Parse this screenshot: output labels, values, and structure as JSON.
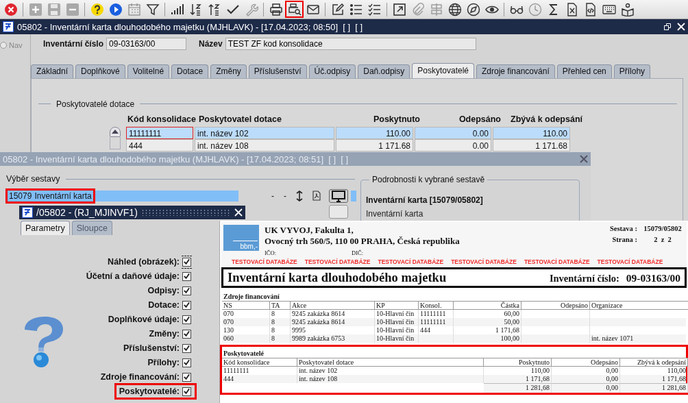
{
  "toolbar": {
    "items": [
      {
        "kind": "close",
        "marked": false
      },
      {
        "kind": "separator"
      },
      {
        "kind": "add",
        "marked": false
      },
      {
        "kind": "save",
        "marked": false
      },
      {
        "kind": "remove",
        "marked": false
      },
      {
        "kind": "separator"
      },
      {
        "kind": "help",
        "marked": false
      },
      {
        "kind": "run",
        "marked": false
      },
      {
        "kind": "calendar",
        "marked": false
      },
      {
        "kind": "filter",
        "marked": false
      },
      {
        "kind": "separator"
      },
      {
        "kind": "signal",
        "marked": false
      },
      {
        "kind": "sort-down",
        "marked": false
      },
      {
        "kind": "sort-up",
        "marked": false
      },
      {
        "kind": "check",
        "marked": false
      },
      {
        "kind": "wrench",
        "marked": false
      },
      {
        "kind": "separator"
      },
      {
        "kind": "printer",
        "marked": false
      },
      {
        "kind": "print-preview",
        "marked": true
      },
      {
        "kind": "mail",
        "marked": false
      },
      {
        "kind": "separator"
      },
      {
        "kind": "edit",
        "marked": false
      },
      {
        "kind": "list",
        "marked": false
      },
      {
        "kind": "checklist",
        "marked": false
      },
      {
        "kind": "separator"
      },
      {
        "kind": "external",
        "marked": false
      },
      {
        "kind": "paperclip",
        "marked": false
      },
      {
        "kind": "signpost",
        "marked": false
      },
      {
        "kind": "globe",
        "marked": false
      },
      {
        "kind": "compass",
        "marked": false
      },
      {
        "kind": "eye",
        "marked": false
      },
      {
        "kind": "separator"
      },
      {
        "kind": "glasses",
        "marked": false
      },
      {
        "kind": "clock",
        "marked": false
      },
      {
        "kind": "sum",
        "marked": false
      },
      {
        "kind": "spreadsheet",
        "marked": false
      },
      {
        "kind": "code",
        "marked": false
      },
      {
        "kind": "keyboard",
        "marked": false
      },
      {
        "kind": "reader",
        "marked": false
      }
    ]
  },
  "main_window": {
    "title": "05802 - Inventární karta dlouhodobého majetku (MJHLAVK) - [17.04.2023; 08:50]  [ ]  [ ]",
    "nav": {
      "label": "Nav",
      "selected": false
    },
    "fields": [
      {
        "label": "Inventární číslo",
        "value": "09-03163/00"
      },
      {
        "label": "Název",
        "value": "TEST ZF kod konsolidace"
      }
    ],
    "tabs": [
      {
        "label": "Základní",
        "selected": false
      },
      {
        "label": "Doplňkové",
        "selected": false
      },
      {
        "label": "Volitelné",
        "selected": false
      },
      {
        "label": "Dotace",
        "selected": false
      },
      {
        "label": "Změny",
        "selected": false
      },
      {
        "label": "Příslušenství",
        "selected": false
      },
      {
        "label": "Úč.odpisy",
        "selected": false
      },
      {
        "label": "Daň.odpisy",
        "selected": false
      },
      {
        "label": "Poskytovatelé",
        "selected": true
      },
      {
        "label": "Zdroje financování",
        "selected": false
      },
      {
        "label": "Přehled cen",
        "selected": false
      },
      {
        "label": "Přílohy",
        "selected": false
      }
    ],
    "section_title": "Poskytovatelé dotace",
    "table": {
      "columns": [
        "Kód konsolidace",
        "Poskytovatel dotace",
        "Poskytnuto",
        "Odepsáno",
        "Zbývá k odepsání"
      ],
      "rows": [
        {
          "cells": [
            "11111111",
            "int. název 102",
            "110.00",
            "0.00",
            "110.00"
          ],
          "selected": true,
          "focused": true
        },
        {
          "cells": [
            "444",
            "int. název 108",
            "1 171.68",
            "0.00",
            "1 171.68"
          ],
          "selected": false,
          "focused": false
        }
      ]
    }
  },
  "report_window": {
    "title": "05802 - Inventární karta dlouhodobého majetku (MJHLAVK) - [17.04.2023; 08:51]  [ ]  [ ]",
    "selection_title": "Výběr sestavy",
    "reports": [
      {
        "code": "15079",
        "name": "Inventární karta",
        "selected": true,
        "marked": true
      }
    ],
    "tools": [
      "-",
      "-"
    ],
    "details": {
      "title": "Podrobnosti k vybrané sestavě",
      "heading": "Inventární karta [15079/05802]",
      "description": "Inventární karta"
    }
  },
  "dialog": {
    "title": "/05802 - (RJ_MJINVF1)",
    "tabs": [
      {
        "label": "Parametry",
        "selected": true
      },
      {
        "label": "Sloupce",
        "selected": false
      }
    ],
    "options": [
      {
        "label": "Náhled (obrázek):",
        "checked": true,
        "focused": true,
        "marked": false
      },
      {
        "label": "Účetní a daňové údaje:",
        "checked": true,
        "focused": false,
        "marked": false
      },
      {
        "label": "Odpisy:",
        "checked": true,
        "focused": false,
        "marked": false
      },
      {
        "label": "Dotace:",
        "checked": true,
        "focused": false,
        "marked": false
      },
      {
        "label": "Doplňkové údaje:",
        "checked": true,
        "focused": false,
        "marked": false
      },
      {
        "label": "Změny:",
        "checked": true,
        "focused": false,
        "marked": false
      },
      {
        "label": "Příslušenství:",
        "checked": true,
        "focused": false,
        "marked": false
      },
      {
        "label": "Přílohy:",
        "checked": true,
        "focused": false,
        "marked": false
      },
      {
        "label": "Zdroje financování:",
        "checked": true,
        "focused": false,
        "marked": false
      },
      {
        "label": "Poskytovatelé:",
        "checked": true,
        "focused": false,
        "marked": true
      }
    ]
  },
  "preview": {
    "logo_text": "bbm,-",
    "company_lines": [
      "UK VYVOJ, Fakulta 1,",
      "Ovocný trh 560/5, 110 00 PRAHA, Česká republika"
    ],
    "meta": [
      {
        "label": "Sestava :",
        "value": "15079/05802"
      },
      {
        "label": "Strana :",
        "value": "2  z  2"
      }
    ],
    "ids": [
      "IČO:",
      "DIČ:"
    ],
    "watermarks": [
      "TESTOVACÍ DATABÁZE",
      "TESTOVACÍ DATABÁZE",
      "TESTOVACÍ DATABÁZE",
      "TESTOVACÍ DATABÁZE",
      "TESTOVACÍ DATABÁZE",
      "TESTOVACÍ DATABÁZE"
    ],
    "title": "Inventární karta dlouhodobého majetku",
    "number_label": "Inventární číslo:",
    "number": "09-03163/00",
    "sections": [
      {
        "title": "Zdroje financování",
        "marked": false,
        "columns": [
          {
            "label": "NS",
            "numeric": false
          },
          {
            "label": "TA",
            "numeric": false
          },
          {
            "label": "Akce",
            "numeric": false
          },
          {
            "label": "KP",
            "numeric": false
          },
          {
            "label": "Konsol.",
            "numeric": false
          },
          {
            "label": "Částka",
            "numeric": true
          },
          {
            "label": "Odepsáno",
            "numeric": true
          },
          {
            "label": "Organizace",
            "numeric": false
          }
        ],
        "rows": [
          [
            "070",
            "8",
            "9245 zakázka 8614",
            "10-Hlavní čin",
            "11111111",
            "60,00",
            null,
            null
          ],
          [
            "070",
            "8",
            "9245 zakázka 8614",
            "10-Hlavní čin",
            "11111111",
            "50,00",
            null,
            null
          ],
          [
            "130",
            "8",
            "9995",
            "10-Hlavní čin",
            "444",
            "1 171,68",
            null,
            null
          ],
          [
            "060",
            "8",
            "9989 zakázka 6753",
            "10-Hlavní čin",
            null,
            "100,00",
            null,
            "int. název 1071"
          ]
        ]
      },
      {
        "title": "Poskytovatelé",
        "marked": true,
        "columns": [
          {
            "label": "Kód konsolidace",
            "numeric": false
          },
          {
            "label": "Poskytovatel dotace",
            "numeric": false
          },
          {
            "label": "Poskytnuto",
            "numeric": true
          },
          {
            "label": "Odepsáno",
            "numeric": true
          },
          {
            "label": "Zbývá k odepsání",
            "numeric": true
          }
        ],
        "rows": [
          [
            "11111111",
            "int. název 102",
            "110,00",
            "0,00",
            "110,00"
          ],
          [
            "444",
            "int. název 108",
            "1 171,68",
            "0,00",
            "1 171,68"
          ]
        ],
        "totals": [
          "1 281,68",
          "0,00",
          "1 281,68"
        ]
      }
    ]
  }
}
